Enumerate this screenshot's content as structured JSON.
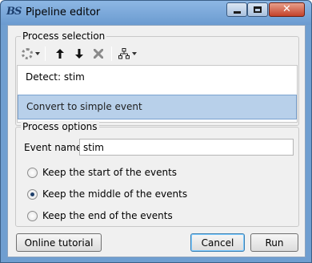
{
  "window": {
    "title": "Pipeline editor",
    "app_icon_text": "BS"
  },
  "process_selection": {
    "title": "Process selection",
    "toolbar": {
      "icons": [
        "gear-icon",
        "arrow-up-icon",
        "arrow-down-icon",
        "delete-icon",
        "tree-icon"
      ]
    },
    "items": [
      {
        "label": "Detect: stim",
        "selected": false
      },
      {
        "label": "Convert to simple event",
        "selected": true
      }
    ]
  },
  "process_options": {
    "title": "Process options",
    "event_names_label": "Event names:",
    "event_names_value": "stim",
    "radios": [
      {
        "label": "Keep the start of the events",
        "checked": false
      },
      {
        "label": "Keep the middle of the events",
        "checked": true
      },
      {
        "label": "Keep the end of the events",
        "checked": false
      }
    ]
  },
  "buttons": {
    "online_tutorial": "Online tutorial",
    "cancel": "Cancel",
    "run": "Run"
  },
  "colors": {
    "selection": "#b8d0ea",
    "titlebar": "#6b9bd0",
    "close_button": "#c4422a"
  }
}
